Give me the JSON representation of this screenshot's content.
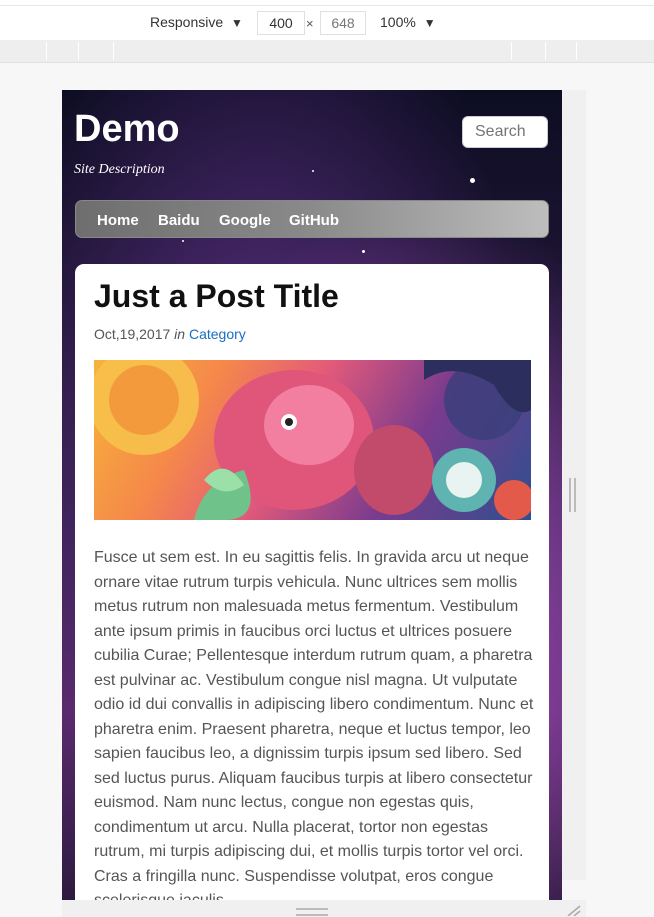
{
  "devtools": {
    "device_label": "Responsive",
    "width": "400",
    "times": "×",
    "height": "648",
    "zoom": "100%",
    "dropdown_icon": "▼"
  },
  "site": {
    "title": "Demo",
    "description": "Site Description",
    "search_placeholder": "Search",
    "nav": [
      "Home",
      "Baidu",
      "Google",
      "GitHub"
    ]
  },
  "post": {
    "title": "Just a Post Title",
    "date": "Oct,19,2017",
    "in_word": "in",
    "category": "Category",
    "image": "koi-fish-illustration",
    "body": "Fusce ut sem est. In eu sagittis felis. In gravida arcu ut neque ornare vitae rutrum turpis vehicula. Nunc ultrices sem mollis metus rutrum non malesuada metus fermentum. Vestibulum ante ipsum primis in faucibus orci luctus et ultrices posuere cubilia Curae; Pellentesque interdum rutrum quam, a pharetra est pulvinar ac. Vestibulum congue nisl magna. Ut vulputate odio id dui convallis in adipiscing libero condimentum. Nunc et pharetra enim. Praesent pharetra, neque et luctus tempor, leo sapien faucibus leo, a dignissim turpis ipsum sed libero. Sed sed luctus purus. Aliquam faucibus turpis at libero consectetur euismod. Nam nunc lectus, congue non egestas quis, condimentum ut arcu. Nulla placerat, tortor non egestas rutrum, mi turpis adipiscing dui, et mollis turpis tortor vel orci. Cras a fringilla nunc. Suspendisse volutpat, eros congue scelerisque iaculis,"
  },
  "colors": {
    "link": "#1a6ec2",
    "nav_start": "#6e6e6e",
    "nav_end": "#bdbdbd"
  }
}
